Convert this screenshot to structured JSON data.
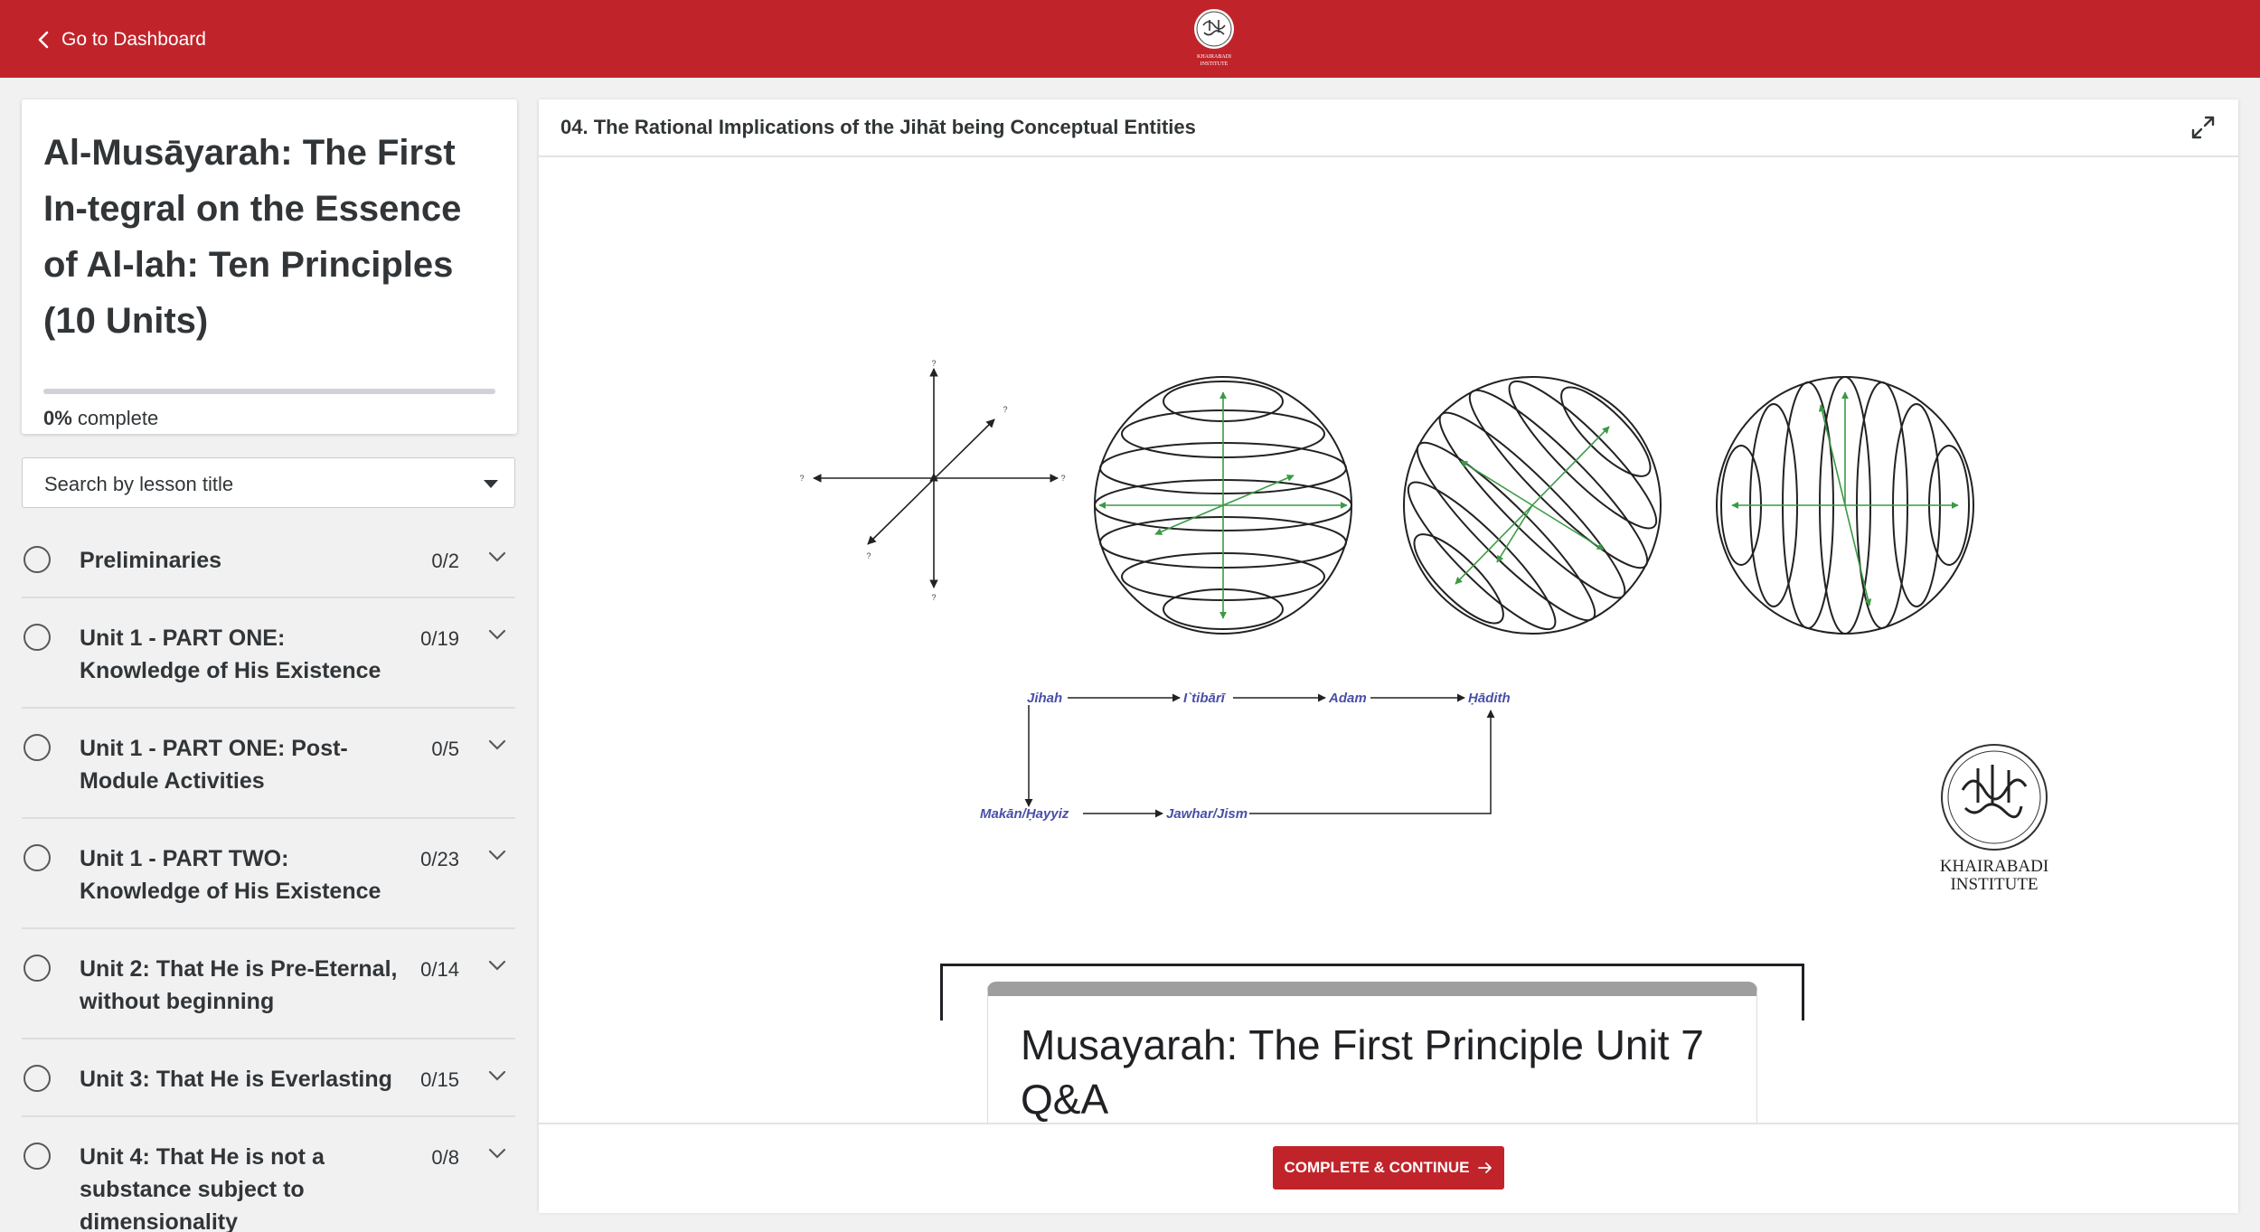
{
  "topbar": {
    "back_label": "Go to Dashboard",
    "logo_text_line1": "KHAIRABADI",
    "logo_text_line2": "INSTITUTE"
  },
  "course": {
    "title": "Al-Musāyarah: The First In-tegral on the Essence of Al-lah: Ten Principles (10 Units)",
    "progress_percent": 0,
    "progress_value": "0%",
    "progress_suffix": "complete"
  },
  "search": {
    "label": "Search by lesson title"
  },
  "sections": [
    {
      "label": "Preliminaries",
      "count": "0/2"
    },
    {
      "label": "Unit 1 - PART ONE: Knowledge of His Existence",
      "count": "0/19"
    },
    {
      "label": "Unit 1 - PART ONE: Post-Module Activities",
      "count": "0/5"
    },
    {
      "label": "Unit 1 - PART TWO: Knowledge of His Existence",
      "count": "0/23"
    },
    {
      "label": "Unit 2: That He is Pre-Eternal, without beginning",
      "count": "0/14"
    },
    {
      "label": "Unit 3: That He is Everlasting",
      "count": "0/15"
    },
    {
      "label": "Unit 4: That He is not a substance subject to dimensionality",
      "count": "0/8"
    }
  ],
  "lesson": {
    "title": "04. The Rational Implications of the Jihāt being Conceptual Entities",
    "diagram": {
      "axis_mark": "?",
      "flow": [
        "Jihah",
        "I`tibārī",
        "Adam",
        "Ḥādith",
        "Makān/Ḥayyiz",
        "Jawhar/Jism"
      ],
      "logo_line1": "KHAIRABADI",
      "logo_line2": "INSTITUTE"
    },
    "embed_title": "Musayarah: The First Principle Unit 7 Q&A",
    "cta_label": "COMPLETE & CONTINUE"
  },
  "colors": {
    "brand_red": "#c0242a",
    "sphere_green": "#3a9a44",
    "flow_blue": "#4a4fa8"
  }
}
